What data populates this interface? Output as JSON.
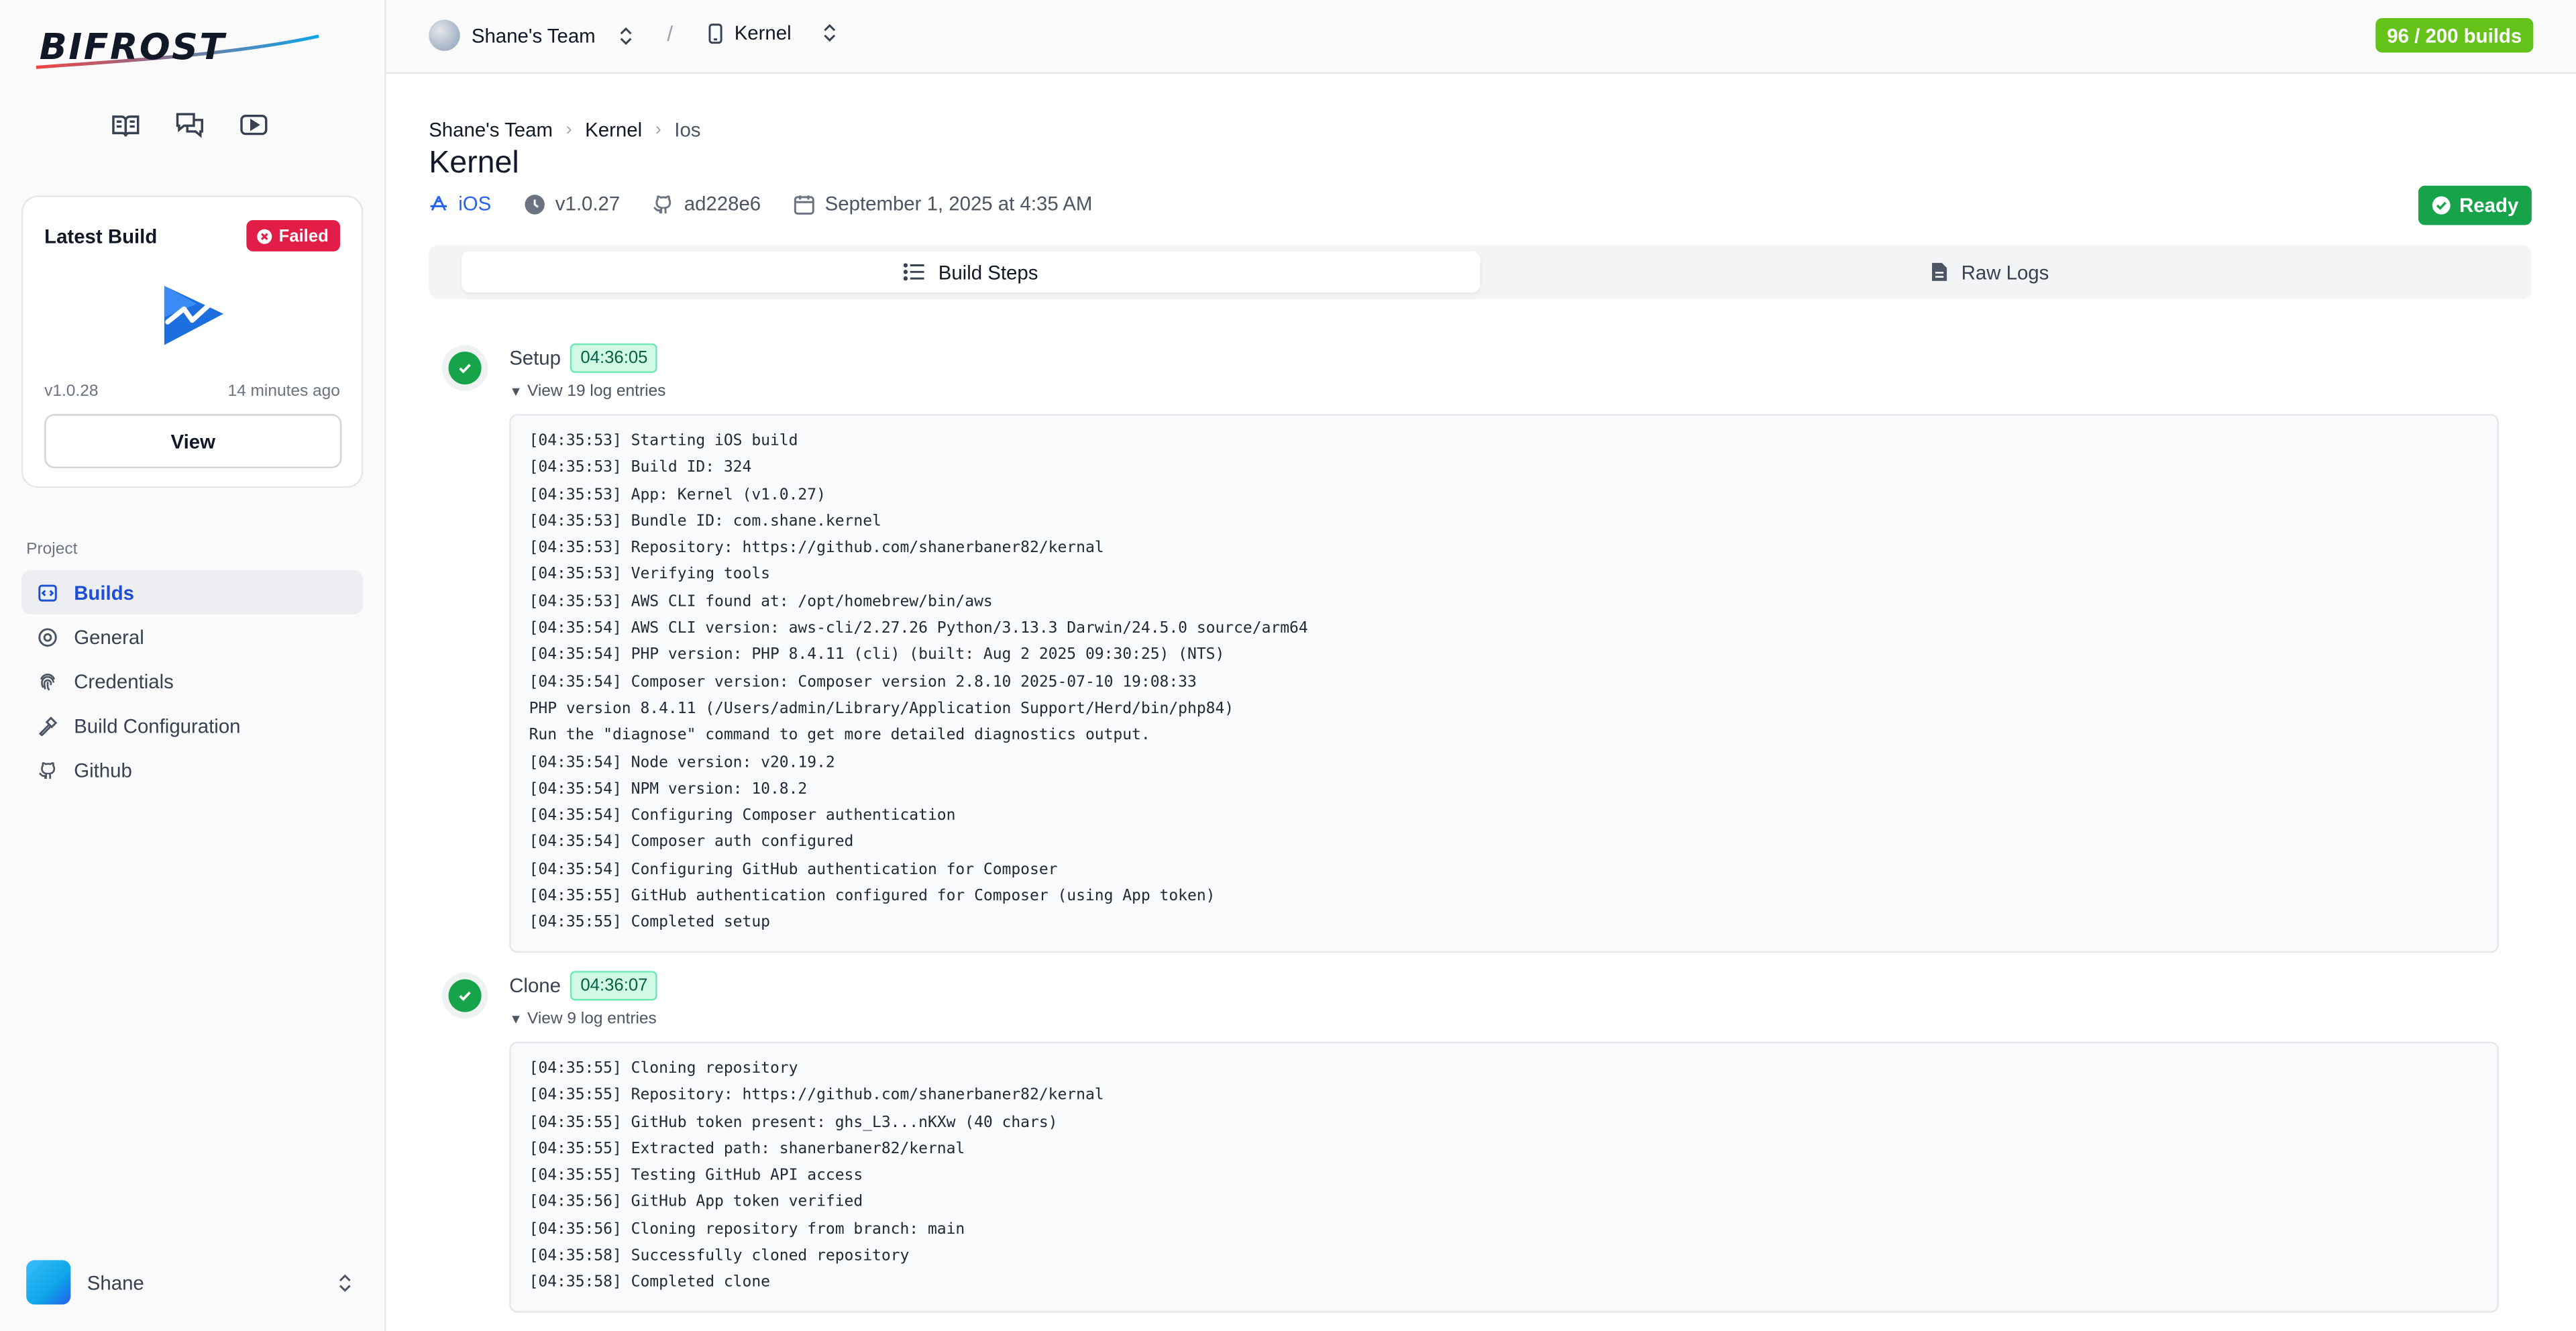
{
  "sidebar": {
    "logo_text": "BIFROST",
    "icons": [
      "docs-icon",
      "chat-icon",
      "video-icon"
    ],
    "latest_build": {
      "title": "Latest Build",
      "status": "Failed",
      "version": "v1.0.28",
      "time": "14 minutes ago",
      "view_label": "View"
    },
    "project_label": "Project",
    "nav": [
      {
        "label": "Builds",
        "icon": "builds-icon",
        "active": true
      },
      {
        "label": "General",
        "icon": "general-icon"
      },
      {
        "label": "Credentials",
        "icon": "fingerprint-icon"
      },
      {
        "label": "Build Configuration",
        "icon": "hammer-icon"
      },
      {
        "label": "Github",
        "icon": "github-icon"
      }
    ],
    "user": {
      "name": "Shane"
    }
  },
  "topbar": {
    "team": "Shane's Team",
    "separator": "/",
    "project": "Kernel",
    "builds_usage": "96 / 200 builds"
  },
  "breadcrumb": [
    "Shane's Team",
    "Kernel",
    "Ios"
  ],
  "page": {
    "title": "Kernel",
    "platform": "iOS",
    "version": "v1.0.27",
    "commit": "ad228e6",
    "date": "September 1, 2025 at 4:35 AM",
    "status": "Ready"
  },
  "tabs": [
    {
      "label": "Build Steps",
      "active": true
    },
    {
      "label": "Raw Logs"
    }
  ],
  "steps": [
    {
      "name": "Setup",
      "time": "04:36:05",
      "toggle": "View 19 log entries",
      "logs": [
        "[04:35:53] Starting iOS build",
        "[04:35:53] Build ID: 324",
        "[04:35:53] App: Kernel (v1.0.27)",
        "[04:35:53] Bundle ID: com.shane.kernel",
        "[04:35:53] Repository: https://github.com/shanerbaner82/kernal",
        "[04:35:53] Verifying tools",
        "[04:35:53] AWS CLI found at: /opt/homebrew/bin/aws",
        "[04:35:54] AWS CLI version: aws-cli/2.27.26 Python/3.13.3 Darwin/24.5.0 source/arm64",
        "[04:35:54] PHP version: PHP 8.4.11 (cli) (built: Aug 2 2025 09:30:25) (NTS)",
        "[04:35:54] Composer version: Composer version 2.8.10 2025-07-10 19:08:33",
        "PHP version 8.4.11 (/Users/admin/Library/Application Support/Herd/bin/php84)",
        "Run the \"diagnose\" command to get more detailed diagnostics output.",
        "[04:35:54] Node version: v20.19.2",
        "[04:35:54] NPM version: 10.8.2",
        "[04:35:54] Configuring Composer authentication",
        "[04:35:54] Composer auth configured",
        "[04:35:54] Configuring GitHub authentication for Composer",
        "[04:35:55] GitHub authentication configured for Composer (using App token)",
        "[04:35:55] Completed setup"
      ]
    },
    {
      "name": "Clone",
      "time": "04:36:07",
      "toggle": "View 9 log entries",
      "logs": [
        "[04:35:55] Cloning repository",
        "[04:35:55] Repository: https://github.com/shanerbaner82/kernal",
        "[04:35:55] GitHub token present: ghs_L3...nKXw (40 chars)",
        "[04:35:55] Extracted path: shanerbaner82/kernal",
        "[04:35:55] Testing GitHub API access",
        "[04:35:56] GitHub App token verified",
        "[04:35:56] Cloning repository from branch: main",
        "[04:35:58] Successfully cloned repository",
        "[04:35:58] Completed clone"
      ]
    }
  ],
  "colors": {
    "accent": "#1d4ed8",
    "failed": "#e11d48",
    "ready": "#16a34a",
    "usage": "#65c219"
  }
}
